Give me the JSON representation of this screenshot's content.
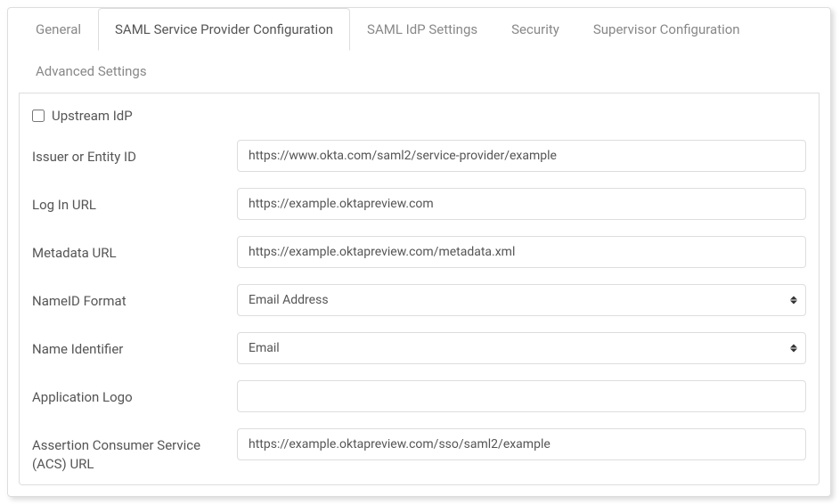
{
  "tabs": {
    "general": "General",
    "saml_sp": "SAML Service Provider Configuration",
    "saml_idp": "SAML IdP Settings",
    "security": "Security",
    "supervisor": "Supervisor Configuration",
    "advanced": "Advanced Settings"
  },
  "form": {
    "upstream_idp_label": "Upstream IdP",
    "upstream_idp_checked": false,
    "issuer_label": "Issuer or Entity ID",
    "issuer_value": "https://www.okta.com/saml2/service-provider/example",
    "login_url_label": "Log In URL",
    "login_url_value": "https://example.oktapreview.com",
    "metadata_url_label": "Metadata URL",
    "metadata_url_value": "https://example.oktapreview.com/metadata.xml",
    "nameid_format_label": "NameID Format",
    "nameid_format_value": "Email Address",
    "name_identifier_label": "Name Identifier",
    "name_identifier_value": "Email",
    "app_logo_label": "Application Logo",
    "app_logo_value": "",
    "acs_url_label": "Assertion Consumer Service (ACS) URL",
    "acs_url_value": "https://example.oktapreview.com/sso/saml2/example"
  }
}
